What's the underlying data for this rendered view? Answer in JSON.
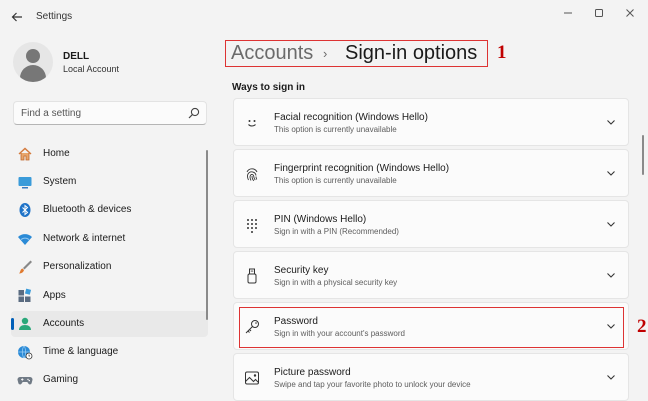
{
  "window": {
    "title": "Settings"
  },
  "profile": {
    "name": "DELL",
    "account_type": "Local Account"
  },
  "search": {
    "placeholder": "Find a setting"
  },
  "nav": [
    {
      "label": "Home",
      "icon": "home-icon"
    },
    {
      "label": "System",
      "icon": "system-icon"
    },
    {
      "label": "Bluetooth & devices",
      "icon": "bluetooth-icon"
    },
    {
      "label": "Network & internet",
      "icon": "wifi-icon"
    },
    {
      "label": "Personalization",
      "icon": "brush-icon"
    },
    {
      "label": "Apps",
      "icon": "apps-icon"
    },
    {
      "label": "Accounts",
      "icon": "accounts-icon",
      "active": true
    },
    {
      "label": "Time & language",
      "icon": "globe-clock-icon"
    },
    {
      "label": "Gaming",
      "icon": "gamepad-icon"
    }
  ],
  "breadcrumb": {
    "parent": "Accounts",
    "separator": "›",
    "current": "Sign-in options"
  },
  "section_title": "Ways to sign in",
  "options": [
    {
      "title": "Facial recognition (Windows Hello)",
      "subtitle": "This option is currently unavailable",
      "icon": "face-icon"
    },
    {
      "title": "Fingerprint recognition (Windows Hello)",
      "subtitle": "This option is currently unavailable",
      "icon": "fingerprint-icon"
    },
    {
      "title": "PIN (Windows Hello)",
      "subtitle": "Sign in with a PIN (Recommended)",
      "icon": "pin-keypad-icon"
    },
    {
      "title": "Security key",
      "subtitle": "Sign in with a physical security key",
      "icon": "usb-key-icon"
    },
    {
      "title": "Password",
      "subtitle": "Sign in with your account's password",
      "icon": "key-icon"
    },
    {
      "title": "Picture password",
      "subtitle": "Swipe and tap your favorite photo to unlock your device",
      "icon": "picture-icon"
    }
  ],
  "annotations": {
    "one": "1",
    "two": "2"
  },
  "colors": {
    "accent": "#005fb8",
    "annotation": "#c00000",
    "background": "#f3f3f3",
    "card": "#fbfbfb"
  }
}
